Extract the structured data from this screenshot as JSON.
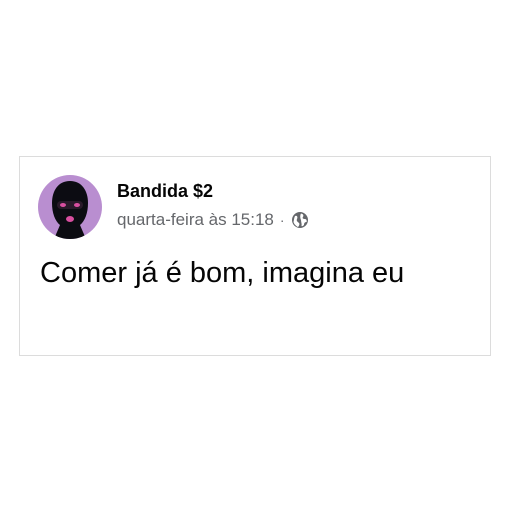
{
  "post": {
    "author_name": "Bandida $2",
    "timestamp": "quarta-feira às 15:18",
    "separator": "·",
    "audience_icon": "globe-icon",
    "text": "Comer já é bom, imagina eu"
  },
  "colors": {
    "avatar_background": "#b98ed0",
    "mask": "#0c0c12",
    "mask_accent": "#d94fa0",
    "meta_text": "#65676b"
  }
}
